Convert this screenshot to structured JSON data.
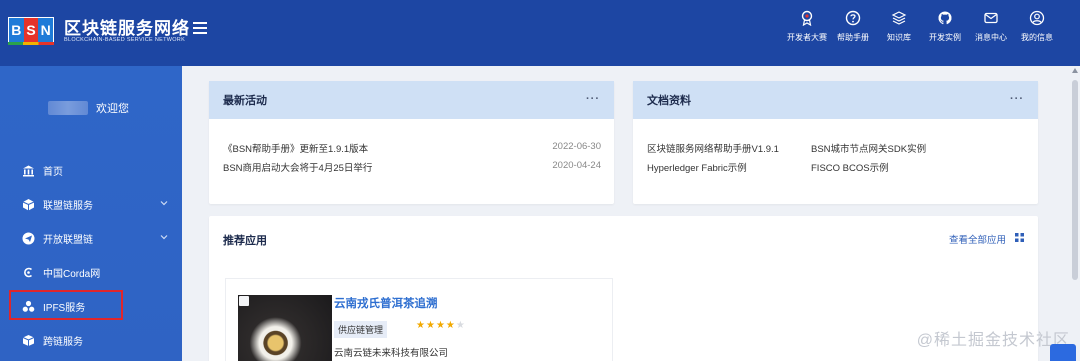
{
  "brand": {
    "logo_letters": [
      "B",
      "S",
      "N"
    ],
    "title": "区块链服务网络",
    "subtitle": "BLOCKCHAIN-BASED SERVICE NETWORK"
  },
  "topnav": [
    {
      "label": "开发者大赛",
      "icon": "award-icon"
    },
    {
      "label": "帮助手册",
      "icon": "help-icon"
    },
    {
      "label": "知识库",
      "icon": "layers-icon"
    },
    {
      "label": "开发实例",
      "icon": "github-icon"
    },
    {
      "label": "消息中心",
      "icon": "mail-icon"
    },
    {
      "label": "我的信息",
      "icon": "user-icon"
    }
  ],
  "sidebar": {
    "welcome": "欢迎您",
    "items": [
      {
        "label": "首页",
        "icon": "bank-icon",
        "has_children": false
      },
      {
        "label": "联盟链服务",
        "icon": "cube-icon",
        "has_children": true
      },
      {
        "label": "开放联盟链",
        "icon": "send-icon",
        "has_children": true
      },
      {
        "label": "中国Corda网",
        "icon": "corda-icon",
        "has_children": false
      },
      {
        "label": "IPFS服务",
        "icon": "ipfs-icon",
        "has_children": false
      },
      {
        "label": "跨链服务",
        "icon": "box-icon",
        "has_children": false
      }
    ]
  },
  "latest": {
    "title": "最新活动",
    "more": "···",
    "items": [
      {
        "text": "《BSN帮助手册》更新至1.9.1版本",
        "date": "2022-06-30"
      },
      {
        "text": "BSN商用启动大会将于4月25日举行",
        "date": "2020-04-24"
      }
    ]
  },
  "docs": {
    "title": "文档资料",
    "more": "···",
    "links": [
      "区块链服务网络帮助手册V1.9.1",
      "BSN城市节点网关SDK实例",
      "Hyperledger Fabric示例",
      "FISCO BCOS示例"
    ]
  },
  "recommended": {
    "title": "推荐应用",
    "view_all": "查看全部应用",
    "app": {
      "name": "云南戎氏普洱茶追溯",
      "tag": "供应链管理",
      "rating": 4,
      "rating_max": 5,
      "company": "云南云链未来科技有限公司"
    }
  },
  "watermark": "@稀土掘金技术社区",
  "colors": {
    "header_bg": "#1d46a3",
    "sidebar_bg": "#2f66c8",
    "card_head_bg": "#cfe0f5",
    "highlight_border": "#e0262b",
    "link_blue": "#2d6ed0",
    "star": "#f2a900"
  }
}
